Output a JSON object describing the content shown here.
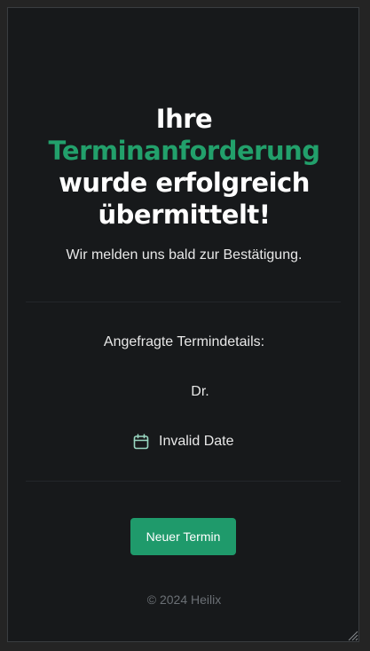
{
  "headline": {
    "line1": "Ihre",
    "line2": "Terminanforderung",
    "line3": "wurde erfolgreich",
    "line4": "übermittelt!"
  },
  "subtext": "Wir melden uns bald zur Bestätigung.",
  "details": {
    "label": "Angefragte Termindetails:",
    "doctor": "Dr.",
    "date": "Invalid Date",
    "date_icon": "calendar-icon"
  },
  "button": {
    "label": "Neuer Termin"
  },
  "footer": "© 2024 Heilix",
  "colors": {
    "background": "#17191b",
    "accent": "#22a06b",
    "button": "#1f9a6b",
    "text": "#e8e8e8",
    "muted": "#6b7075"
  }
}
